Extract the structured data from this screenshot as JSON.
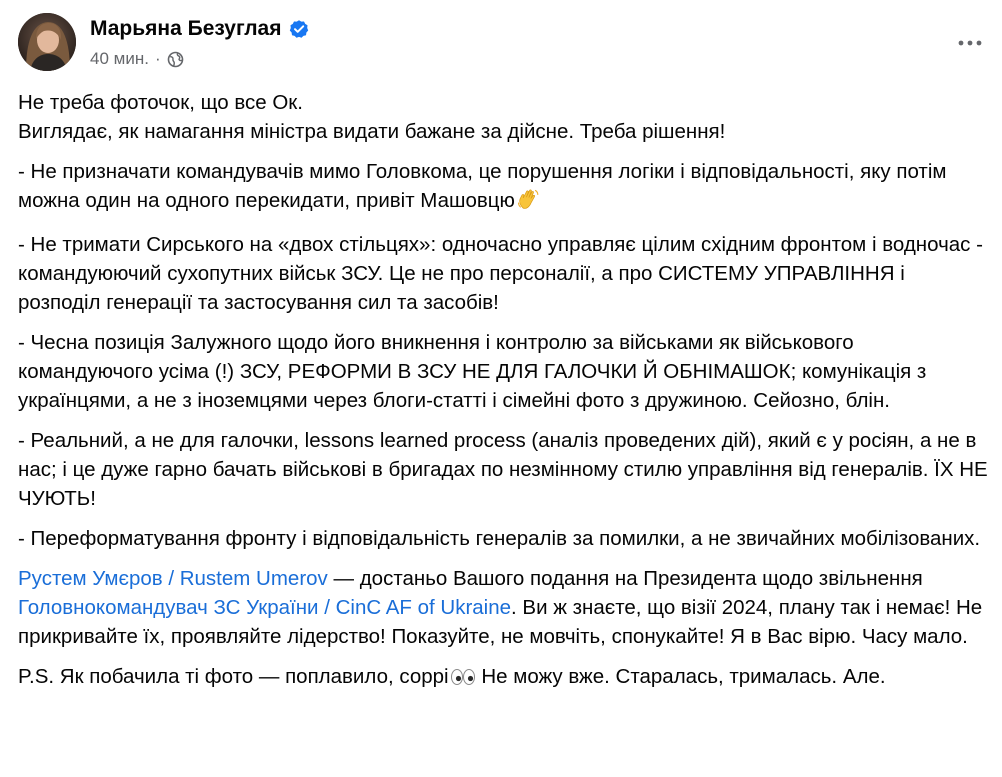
{
  "author": {
    "name": "Марьяна Безуглая",
    "verified_icon": "verified-badge-icon",
    "verified_color": "#1877f2"
  },
  "meta": {
    "time": "40 мин.",
    "separator": "·",
    "audience_icon": "globe-icon"
  },
  "menu": {
    "icon": "more-dots-icon"
  },
  "colors": {
    "text": "#050505",
    "secondary": "#65676b",
    "link": "#1a6ed8"
  },
  "post": {
    "line1": "Не треба фоточок, що все Ок.",
    "line2": "Виглядає, як намагання міністра видати бажане за дійсне. Треба рішення!",
    "p1": "- Не призначати командувачів мимо Головкома, це порушення логіки і відповідальності, яку потім можна один на одного перекидати, привіт Машовцю",
    "p1_emoji": "waving-hand-icon",
    "p2": "- Не тримати Сирського на «двох стільцях»: одночасно управляє цілим східним фронтом і водночас - командуюючий сухопутних військ ЗСУ. Це не про персоналії, а про СИСТЕМУ УПРАВЛІННЯ і розподіл генерації та застосування сил та засобів!",
    "p3": "- Чесна позиція Залужного щодо його вникнення і контролю за військами як військового командуючого усіма (!) ЗСУ, РЕФОРМИ В ЗСУ НЕ ДЛЯ ГАЛОЧКИ Й ОБНІМАШОК; комунікація з українцями, а не з іноземцями через блоги-статті і сімейні фото з дружиною. Сейозно, блін.",
    "p4": "- Реальний, а не для галочки, lessons learned process (аналіз проведених дій), який є у росіян, а не в нас; і це дуже гарно бачать військові в бригадах по незмінному стилю управління від генералів. ЇХ НЕ ЧУЮТЬ!",
    "p5": "- Переформатування фронту і відповідальність генералів за помилки, а не звичайних мобілізованих.",
    "p6_link1": "Рустем Умєров / Rustem Umerov",
    "p6_text1": " — достаньо Вашого подання на Президента щодо звільнення ",
    "p6_link2": "Головнокомандувач ЗС України / CinC AF of Ukraine",
    "p6_text2": ". Ви ж знаєте, що візії 2024, плану так і немає! Не прикривайте їх, проявляйте лідерство! Показуйте, не мовчіть, спонукайте! Я в Вас вірю. Часу мало.",
    "p7_text1": "P.S. Як побачила ті фото — поплавило, соррі",
    "p7_emoji": "eyes-icon",
    "p7_text2": " Не можу вже. Старалась, трималась. Але."
  }
}
